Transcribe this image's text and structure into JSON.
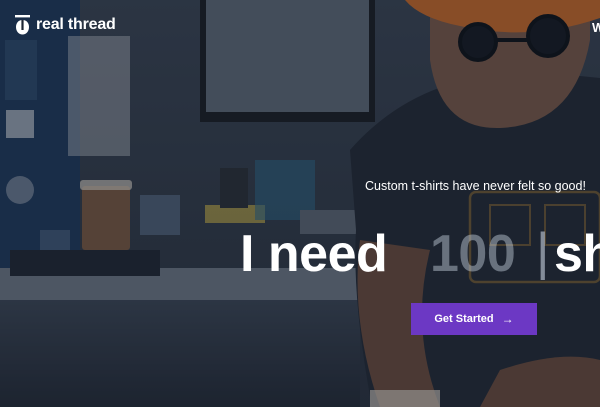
{
  "brand": {
    "name": "real thread",
    "logo_icon": "real-thread-logo-icon"
  },
  "nav": {
    "cut_label": "W"
  },
  "hero": {
    "tagline": "Custom t-shirts have never felt so good!",
    "headline_prefix": "I need",
    "quantity": "100",
    "cursor": "|",
    "item": "sh",
    "cta_label": "Get Started",
    "cta_icon": "arrow-right-icon",
    "accent_color": "#6c38c4"
  }
}
